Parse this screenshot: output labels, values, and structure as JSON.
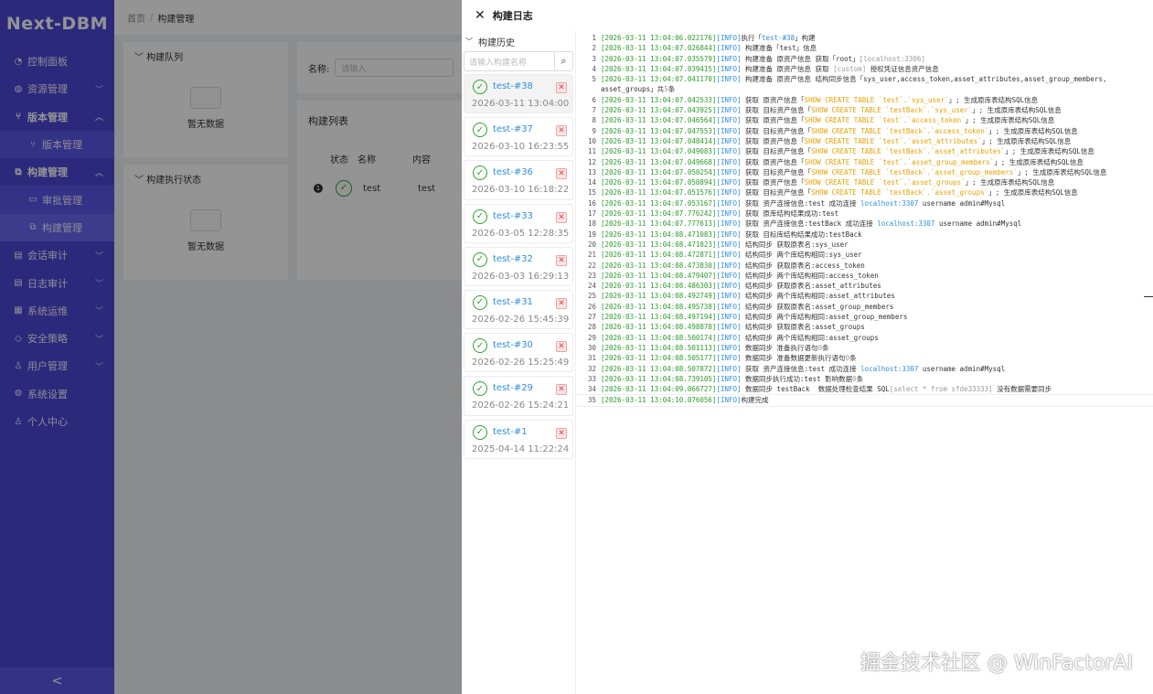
{
  "sidebar": {
    "logo": "Next-DBM",
    "items": [
      {
        "label": "控制面板",
        "icon": "◔"
      },
      {
        "label": "资源管理",
        "icon": "◍"
      },
      {
        "label": "版本管理",
        "icon": "⑂"
      },
      {
        "label": "版本管理",
        "icon": "⑂"
      },
      {
        "label": "构建管理",
        "icon": "⧉"
      },
      {
        "label": "审批管理",
        "icon": "▭"
      },
      {
        "label": "构建管理",
        "icon": "⧉"
      },
      {
        "label": "会话审计",
        "icon": "▤"
      },
      {
        "label": "日志审计",
        "icon": "▤"
      },
      {
        "label": "系统运维",
        "icon": "▦"
      },
      {
        "label": "安全策略",
        "icon": "◇"
      },
      {
        "label": "用户管理",
        "icon": "♙"
      },
      {
        "label": "系统设置",
        "icon": "⚙"
      },
      {
        "label": "个人中心",
        "icon": "♙"
      }
    ],
    "collapse": "<"
  },
  "main": {
    "breadcrumb": {
      "home": "首页",
      "sep": "/",
      "current": "构建管理"
    },
    "queue": {
      "title": "构建队列",
      "empty": "暂无数据"
    },
    "exec": {
      "title": "构建执行状态",
      "empty": "暂无数据"
    },
    "filter": {
      "label": "名称:",
      "placeholder": "请输入"
    },
    "list": {
      "title": "构建列表",
      "headers": [
        "状态",
        "名称",
        "内容"
      ],
      "row": {
        "index": "1",
        "name": "test",
        "content": "test"
      }
    }
  },
  "drawer": {
    "title": "构建日志",
    "history_title": "构建历史",
    "search_placeholder": "请输入构建名称",
    "builds": [
      {
        "name": "test-#38",
        "time": "2026-03-11 13:04:00"
      },
      {
        "name": "test-#37",
        "time": "2026-03-10 16:23:55"
      },
      {
        "name": "test-#36",
        "time": "2026-03-10 16:18:22"
      },
      {
        "name": "test-#33",
        "time": "2026-03-05 12:28:35"
      },
      {
        "name": "test-#32",
        "time": "2026-03-03 16:29:13"
      },
      {
        "name": "test-#31",
        "time": "2026-02-26 15:45:39"
      },
      {
        "name": "test-#30",
        "time": "2026-02-26 15:25:49"
      },
      {
        "name": "test-#29",
        "time": "2026-02-26 15:24:21"
      },
      {
        "name": "test-#1",
        "time": "2025-04-14 11:22:24"
      }
    ],
    "log": [
      [
        [
          "ts",
          "[2026-03-11 13:04:06.022176]"
        ],
        [
          "lv",
          "[INFO]"
        ],
        [
          "t",
          "执行「"
        ],
        [
          "hl",
          "test-#38"
        ],
        [
          "t",
          "」构建"
        ]
      ],
      [
        [
          "ts",
          "[2026-03-11 13:04:07.026844]"
        ],
        [
          "lv",
          "[INFO]"
        ],
        [
          "t",
          " 构建准备「test」信息"
        ]
      ],
      [
        [
          "ts",
          "[2026-03-11 13:04:07.035579]"
        ],
        [
          "lv",
          "[INFO]"
        ],
        [
          "t",
          " 构建准备 原资产信息 获取「root」"
        ],
        [
          "dim",
          "[localhost:3306]"
        ]
      ],
      [
        [
          "ts",
          "[2026-03-11 13:04:07.039415]"
        ],
        [
          "lv",
          "[INFO]"
        ],
        [
          "t",
          " 构建准备 原资产信息 获取 "
        ],
        [
          "dim",
          "[custom]"
        ],
        [
          "t",
          " 授权凭证信息资产信息"
        ]
      ],
      [
        [
          "ts",
          "[2026-03-11 13:04:07.041170]"
        ],
        [
          "lv",
          "[INFO]"
        ],
        [
          "t",
          " 构建准备 原资产信息 结构同步信息「sys_user,access_token,asset_attributes,asset_group_members,\nasset_groups」共"
        ],
        [
          "dim",
          "5"
        ],
        [
          "t",
          "条"
        ]
      ],
      [
        [
          "ts",
          "[2026-03-11 13:04:07.042533]"
        ],
        [
          "lv",
          "[INFO]"
        ],
        [
          "t",
          " 获取 原资产信息「"
        ],
        [
          "sql",
          "SHOW CREATE TABLE `test`.`sys_user`"
        ],
        [
          "t",
          "」; 生成原库表结构SQL信息"
        ]
      ],
      [
        [
          "ts",
          "[2026-03-11 13:04:07.043925]"
        ],
        [
          "lv",
          "[INFO]"
        ],
        [
          "t",
          " 获取 目标资产信息「"
        ],
        [
          "sql",
          "SHOW CREATE TABLE `testBack`.`sys_user`"
        ],
        [
          "t",
          "」; 生成原库表结构SQL信息"
        ]
      ],
      [
        [
          "ts",
          "[2026-03-11 13:04:07.046564]"
        ],
        [
          "lv",
          "[INFO]"
        ],
        [
          "t",
          " 获取 原资产信息「"
        ],
        [
          "sql",
          "SHOW CREATE TABLE `test`.`access_token`"
        ],
        [
          "t",
          "」; 生成原库表结构SQL信息"
        ]
      ],
      [
        [
          "ts",
          "[2026-03-11 13:04:07.047553]"
        ],
        [
          "lv",
          "[INFO]"
        ],
        [
          "t",
          " 获取 目标资产信息「"
        ],
        [
          "sql",
          "SHOW CREATE TABLE `testBack`.`access_token`"
        ],
        [
          "t",
          "」; 生成原库表结构SQL信息"
        ]
      ],
      [
        [
          "ts",
          "[2026-03-11 13:04:07.048414]"
        ],
        [
          "lv",
          "[INFO]"
        ],
        [
          "t",
          " 获取 原资产信息「"
        ],
        [
          "sql",
          "SHOW CREATE TABLE `test`.`asset_attributes`"
        ],
        [
          "t",
          "」; 生成原库表结构SQL信息"
        ]
      ],
      [
        [
          "ts",
          "[2026-03-11 13:04:07.049083]"
        ],
        [
          "lv",
          "[INFO]"
        ],
        [
          "t",
          " 获取 目标资产信息「"
        ],
        [
          "sql",
          "SHOW CREATE TABLE `testBack`.`asset_attributes`"
        ],
        [
          "t",
          "」; 生成原库表结构SQL信息"
        ]
      ],
      [
        [
          "ts",
          "[2026-03-11 13:04:07.049668]"
        ],
        [
          "lv",
          "[INFO]"
        ],
        [
          "t",
          " 获取 原资产信息「"
        ],
        [
          "sql",
          "SHOW CREATE TABLE `test`.`asset_group_members`"
        ],
        [
          "t",
          "」; 生成原库表结构SQL信息"
        ]
      ],
      [
        [
          "ts",
          "[2026-03-11 13:04:07.050254]"
        ],
        [
          "lv",
          "[INFO]"
        ],
        [
          "t",
          " 获取 目标资产信息「"
        ],
        [
          "sql",
          "SHOW CREATE TABLE `testBack`.`asset_group_members`"
        ],
        [
          "t",
          "」; 生成原库表结构SQL信息"
        ]
      ],
      [
        [
          "ts",
          "[2026-03-11 13:04:07.050894]"
        ],
        [
          "lv",
          "[INFO]"
        ],
        [
          "t",
          " 获取 原资产信息「"
        ],
        [
          "sql",
          "SHOW CREATE TABLE `test`.`asset_groups`"
        ],
        [
          "t",
          "」; 生成原库表结构SQL信息"
        ]
      ],
      [
        [
          "ts",
          "[2026-03-11 13:04:07.051576]"
        ],
        [
          "lv",
          "[INFO]"
        ],
        [
          "t",
          " 获取 目标资产信息「"
        ],
        [
          "sql",
          "SHOW CREATE TABLE `testBack`.`asset_groups`"
        ],
        [
          "t",
          "」; 生成原库表结构SQL信息"
        ]
      ],
      [
        [
          "ts",
          "[2026-03-11 13:04:07.053167]"
        ],
        [
          "lv",
          "[INFO]"
        ],
        [
          "t",
          " 获取 资产连接信息:test 成功连接 "
        ],
        [
          "hl",
          "localhost:3307"
        ],
        [
          "t",
          " username admin#Mysql"
        ]
      ],
      [
        [
          "ts",
          "[2026-03-11 13:04:07.776242]"
        ],
        [
          "lv",
          "[INFO]"
        ],
        [
          "t",
          " 获取 原库结构结果成功:test"
        ]
      ],
      [
        [
          "ts",
          "[2026-03-11 13:04:07.777613]"
        ],
        [
          "lv",
          "[INFO]"
        ],
        [
          "t",
          " 获取 资产连接信息:testBack 成功连接 "
        ],
        [
          "hl",
          "localhost:3307"
        ],
        [
          "t",
          " username admin#Mysql"
        ]
      ],
      [
        [
          "ts",
          "[2026-03-11 13:04:08.471083]"
        ],
        [
          "lv",
          "[INFO]"
        ],
        [
          "t",
          " 获取 目标库结构结果成功:testBack"
        ]
      ],
      [
        [
          "ts",
          "[2026-03-11 13:04:08.471823]"
        ],
        [
          "lv",
          "[INFO]"
        ],
        [
          "t",
          " 结构同步 获取原表名:sys_user"
        ]
      ],
      [
        [
          "ts",
          "[2026-03-11 13:04:08.472871]"
        ],
        [
          "lv",
          "[INFO]"
        ],
        [
          "t",
          " 结构同步 两个库结构相同:sys_user"
        ]
      ],
      [
        [
          "ts",
          "[2026-03-11 13:04:08.473830]"
        ],
        [
          "lv",
          "[INFO]"
        ],
        [
          "t",
          " 结构同步 获取原表名:access_token"
        ]
      ],
      [
        [
          "ts",
          "[2026-03-11 13:04:08.479407]"
        ],
        [
          "lv",
          "[INFO]"
        ],
        [
          "t",
          " 结构同步 两个库结构相同:access_token"
        ]
      ],
      [
        [
          "ts",
          "[2026-03-11 13:04:08.486303]"
        ],
        [
          "lv",
          "[INFO]"
        ],
        [
          "t",
          " 结构同步 获取原表名:asset_attributes"
        ]
      ],
      [
        [
          "ts",
          "[2026-03-11 13:04:08.492749]"
        ],
        [
          "lv",
          "[INFO]"
        ],
        [
          "t",
          " 结构同步 两个库结构相同:asset_attributes"
        ]
      ],
      [
        [
          "ts",
          "[2026-03-11 13:04:08.495738]"
        ],
        [
          "lv",
          "[INFO]"
        ],
        [
          "t",
          " 结构同步 获取原表名:asset_group_members"
        ]
      ],
      [
        [
          "ts",
          "[2026-03-11 13:04:08.497194]"
        ],
        [
          "lv",
          "[INFO]"
        ],
        [
          "t",
          " 结构同步 两个库结构相同:asset_group_members"
        ]
      ],
      [
        [
          "ts",
          "[2026-03-11 13:04:08.498878]"
        ],
        [
          "lv",
          "[INFO]"
        ],
        [
          "t",
          " 结构同步 获取原表名:asset_groups"
        ]
      ],
      [
        [
          "ts",
          "[2026-03-11 13:04:08.500174]"
        ],
        [
          "lv",
          "[INFO]"
        ],
        [
          "t",
          " 结构同步 两个库结构相同:asset_groups"
        ]
      ],
      [
        [
          "ts",
          "[2026-03-11 13:04:08.501113]"
        ],
        [
          "lv",
          "[INFO]"
        ],
        [
          "t",
          " 数据同步 准备执行语句"
        ],
        [
          "dim",
          "0"
        ],
        [
          "t",
          "条"
        ]
      ],
      [
        [
          "ts",
          "[2026-03-11 13:04:08.505177]"
        ],
        [
          "lv",
          "[INFO]"
        ],
        [
          "t",
          " 数据同步 准备数据更新执行语句"
        ],
        [
          "dim",
          "0"
        ],
        [
          "t",
          "条"
        ]
      ],
      [
        [
          "ts",
          "[2026-03-11 13:04:08.507872]"
        ],
        [
          "lv",
          "[INFO]"
        ],
        [
          "t",
          " 获取 资产连接信息:test 成功连接 "
        ],
        [
          "hl",
          "localhost:3307"
        ],
        [
          "t",
          " username admin#Mysql"
        ]
      ],
      [
        [
          "ts",
          "[2026-03-11 13:04:08.739105]"
        ],
        [
          "lv",
          "[INFO]"
        ],
        [
          "t",
          " 数据同步执行成功:test 影响数据"
        ],
        [
          "dim",
          "0"
        ],
        [
          "t",
          "条"
        ]
      ],
      [
        [
          "ts",
          "[2026-03-11 13:04:09.066727]"
        ],
        [
          "lv",
          "[INFO]"
        ],
        [
          "t",
          " 数据同步 testBack  数据处理检查结果 SQL"
        ],
        [
          "dim",
          "[select * from sfde33333]"
        ],
        [
          "t",
          " 没有数据需要同步"
        ]
      ],
      [
        [
          "ts",
          "[2026-03-11 13:04:10.076056]"
        ],
        [
          "lv",
          "[INFO]"
        ],
        [
          "t",
          "构建完成"
        ]
      ]
    ]
  },
  "watermark": "掘金技术社区 @ WinFactorAI"
}
